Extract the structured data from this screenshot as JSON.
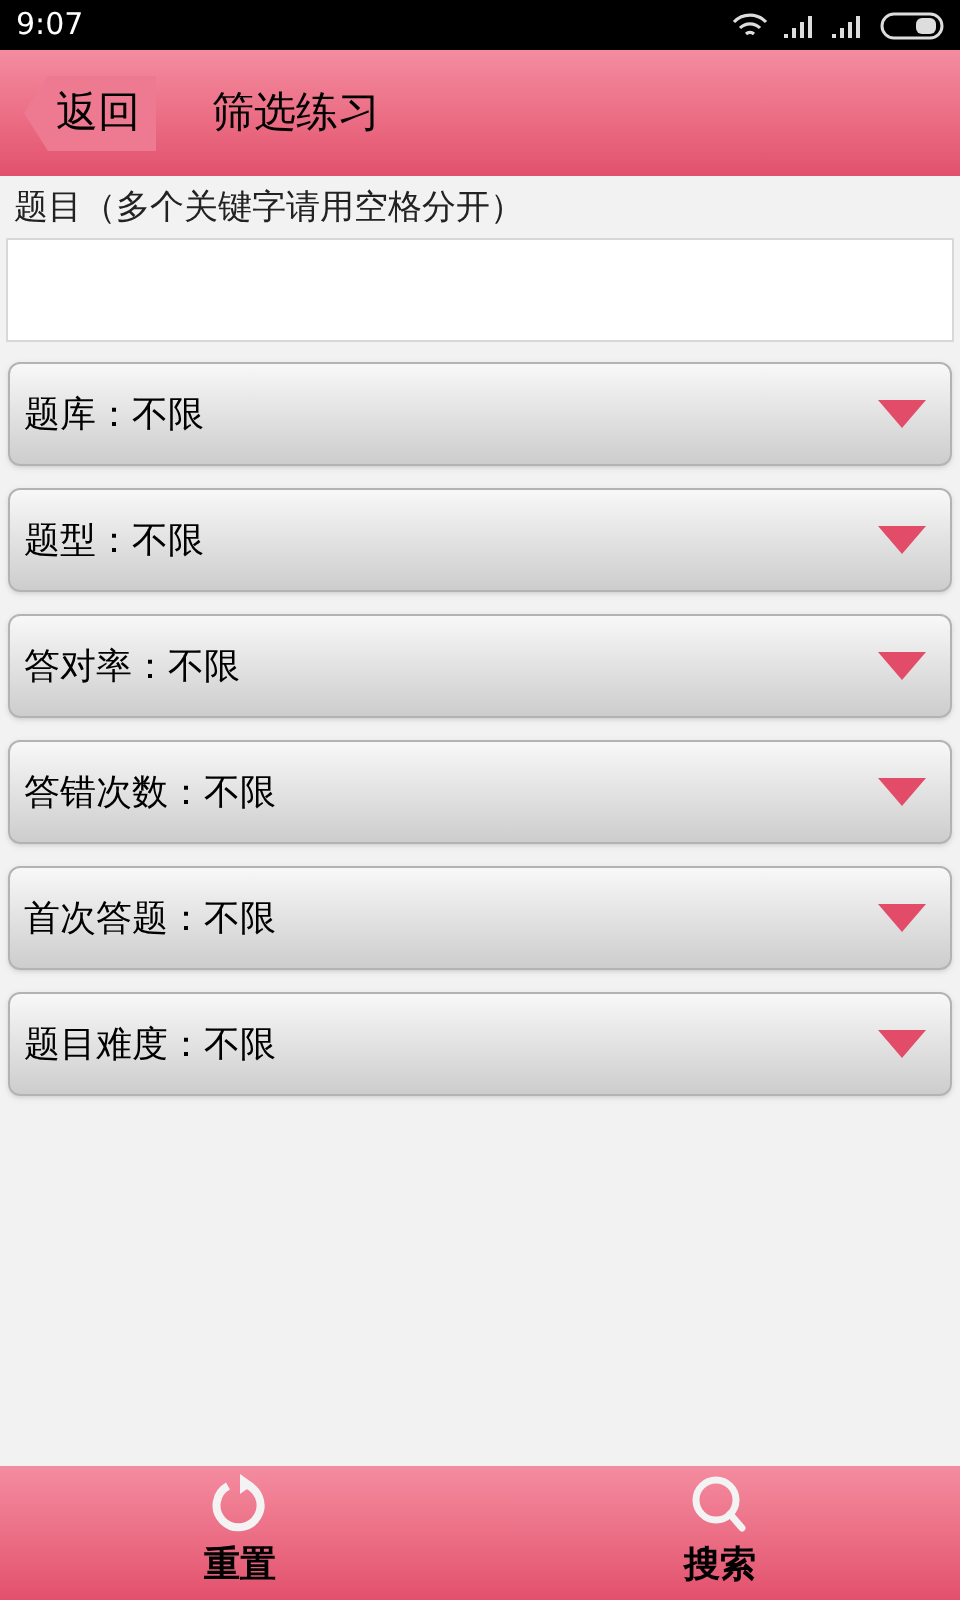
{
  "status_bar": {
    "time": "9:07"
  },
  "header": {
    "back": "返回",
    "title": "筛选练习"
  },
  "keyword": {
    "label": "题目（多个关键字请用空格分开）"
  },
  "filters": [
    {
      "label": "题库：不限"
    },
    {
      "label": "题型：不限"
    },
    {
      "label": "答对率：不限"
    },
    {
      "label": "答错次数：不限"
    },
    {
      "label": "首次答题：不限"
    },
    {
      "label": "题目难度：不限"
    }
  ],
  "bottom_bar": [
    {
      "kind": "reset",
      "label": "重置"
    },
    {
      "kind": "search",
      "label": "搜索"
    }
  ]
}
